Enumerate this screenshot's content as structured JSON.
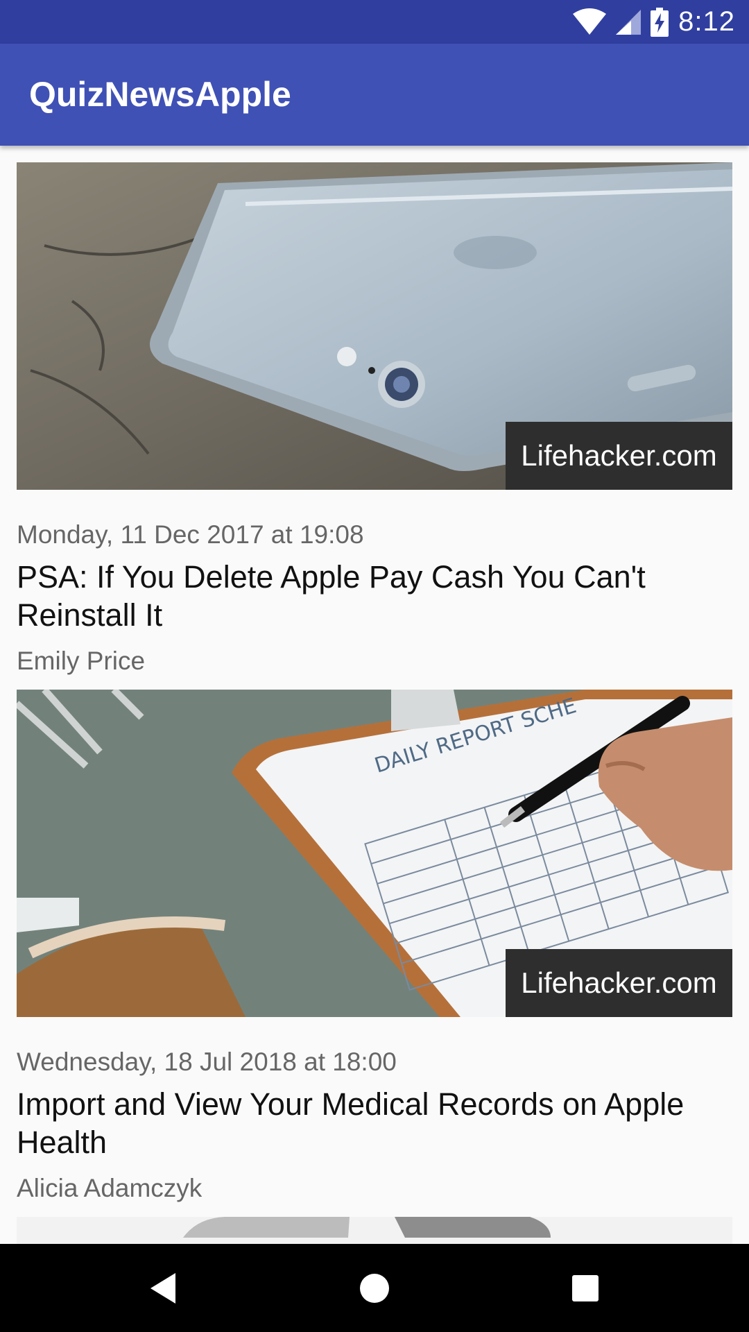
{
  "status_bar": {
    "time": "8:12",
    "icons": [
      "wifi-icon",
      "cell-signal-icon",
      "battery-charging-icon"
    ]
  },
  "app_bar": {
    "title": "QuizNewsApple"
  },
  "articles": [
    {
      "source": "Lifehacker.com",
      "date": "Monday, 11 Dec 2017 at 19:08",
      "title": "PSA: If You Delete Apple Pay Cash You Can't Reinstall It",
      "author": "Emily Price",
      "image": "iphone-back-photo"
    },
    {
      "source": "Lifehacker.com",
      "date": "Wednesday, 18 Jul 2018 at 18:00",
      "title": "Import and View Your Medical Records on Apple Health",
      "author": "Alicia Adamczyk",
      "image": "medical-clipboard-photo"
    }
  ],
  "nav_bar": {
    "buttons": [
      "back-icon",
      "home-icon",
      "recents-icon"
    ]
  },
  "colors": {
    "primary": "#3f51b5",
    "primary_dark": "#303f9f",
    "badge": "#2e2e2e"
  }
}
